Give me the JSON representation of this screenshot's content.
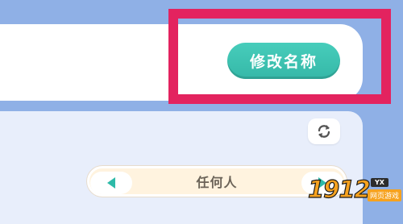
{
  "rename_button_label": "修改名称",
  "selector": {
    "value": "任何人"
  },
  "icons": {
    "refresh": "refresh-icon",
    "left": "triangle-left-icon",
    "right": "triangle-right-icon"
  },
  "colors": {
    "background": "#8fb0e6",
    "accent_teal": "#3fc2b1",
    "highlight": "#e3235f",
    "selector_fill": "#fff3df",
    "panel": "#e8eefb"
  },
  "watermark": {
    "number": "1912",
    "badge": "YX",
    "caption": "网页游戏"
  }
}
